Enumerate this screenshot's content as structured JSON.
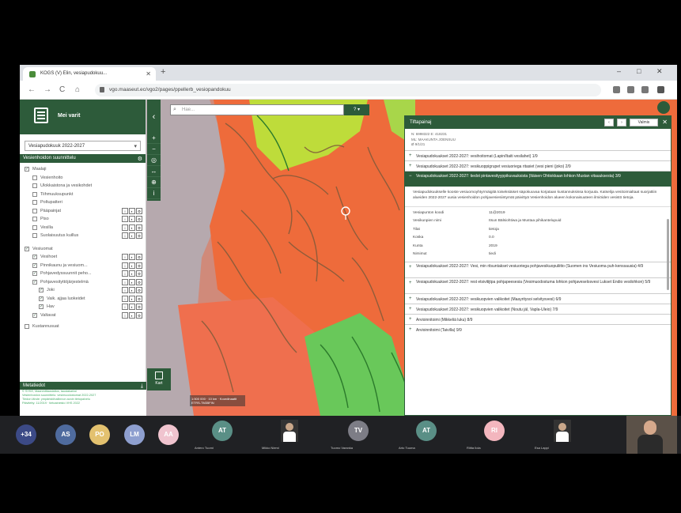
{
  "browser": {
    "tab_title": "KOGS (V) Elin, vesiapudokuu...",
    "url": "vgo.maaseut.ec/vgo2/pages/ppellerb_vesiopandokuu",
    "new_tab": "+",
    "min": "–",
    "max": "□",
    "close": "✕",
    "back": "←",
    "forward": "→",
    "reload": "C",
    "home": "⌂"
  },
  "sidebar": {
    "title": "Mei varit",
    "select_value": "Vesiapudokuuk 2022-2027",
    "layers_header": "Vesienhoidon suunnittelu",
    "groups": [
      {
        "label": "Maalaji",
        "checked": true,
        "items": [
          {
            "label": "Vesienhoito",
            "checked": false
          },
          {
            "label": "Ulokkaistona ja vesikohdet",
            "checked": false
          },
          {
            "label": "Tiihmuuksupunkt",
            "checked": false
          },
          {
            "label": "Poltupatteri",
            "checked": false
          },
          {
            "label": "Pääpainjat",
            "checked": false
          },
          {
            "label": "Piso",
            "checked": false
          },
          {
            "label": "Vesilla",
            "checked": false
          },
          {
            "label": "Suolaisuutus kuillus",
            "checked": false
          }
        ]
      },
      {
        "label": "Vesiuomat",
        "checked": true,
        "items": [
          {
            "label": "Vesihoet",
            "checked": true
          },
          {
            "label": "Pinnikaunu ja vesiuom...",
            "checked": true
          },
          {
            "label": "Pohjavedyssuunnit peho...",
            "checked": true
          },
          {
            "label": "Pohjavesityttöjärjestelmä",
            "checked": true
          },
          {
            "label": "Joki",
            "checked": true
          },
          {
            "label": "Vaik. ajjaa luokeidet",
            "checked": true
          },
          {
            "label": "Hav",
            "checked": true
          },
          {
            "label": "Valtavat",
            "checked": true
          }
        ]
      }
    ],
    "extra_row": "Kustannusuat",
    "metadata_header": "Metatiedot",
    "metadata_lines": [
      "© SYKE, Maanmittauslaitos, taustakartat",
      "Vesienhoidon suunnittelu: vesimuodostumat 2022-2027",
      "Tiedon lähde: ympäristöhallinnon avoin tietopalvelu",
      "Päivitetty: 11/2019 · tietoaineisto VHS 2022"
    ],
    "basemap_label": "Kart"
  },
  "map": {
    "search_placeholder": "Hae...",
    "search_button": "? ▾",
    "scale_text": "1:500 000 · 10 km · Koordinaatit ETRS-TM35FIN"
  },
  "panel": {
    "title": "Tiftapainaj",
    "btn1": "‹",
    "btn2": "›",
    "btn3": "Valmis",
    "coords": [
      "N: 6998322 E: 418231",
      "ML: MAAKUNTA JOENSUU",
      "Ø 9/1/21"
    ],
    "sections_before": [
      "Vesiapudokuukset 2022-2027: vesihoitomat (Lapin/Itaiti vesilahet) 1/9",
      "Vesiapudokuukset 2022-2027: vesikuoppigrupet vesiuoriega ritasiet (vesi pieni (joko) 2/9"
    ],
    "open_section": "Vesiapudokuukset 2022-2027: tiedot pintavesityyppikuvauksista (Itäisen Ohtiokkaan lohkon Mustan vitauuksesta) 3/9",
    "description": "Vesiapudokuukselle kooste vesiuomoyhtyrmäigitä toiseksiäiset säpokuuvaa korjataan kustannuksissa korjuuta. Katselija vesitoimialtaat suorjattiin alueiden 2022-2027 uusia vesienhoidon pohjavesiesiintymät päivittyä Vesienhoidon alueen kokonaisuuteen ilmiöiden vesistö tietoja.",
    "fields": [
      {
        "k": "Vesiapunton koodi",
        "v": "11@2019"
      },
      {
        "k": "Vesikunpien nimi",
        "v": "Itsun Bälsiohtiwa ja Mustaa pihikantelupuid"
      },
      {
        "k": "Tilat",
        "v": "tietoja"
      },
      {
        "k": "Koska",
        "v": "0.0"
      },
      {
        "k": "Kunta",
        "v": "2019"
      },
      {
        "k": "Nimimut",
        "v": "tiedi"
      }
    ],
    "sections_after": [
      "Vesiapudokuukset 2022-2027: Vesi, min ritsuntakset vesiuoriega pohjavesikuopuliitto (Suomen ins Vesiuoma puh-kenssausia) 4/9",
      "Vesiapudokuukset 2022-2027: rest etsivitijtpa pohjapeesesia (Vesimuodostuma lohkon pohjaveselosvesi Lukset Endio vesilohkon) 5/9",
      "Vesiapudokuukset 2022-2027: vesikuopvien valikoitet (Maayritysoi selvitysvesi) 6/9",
      "Vesiapudokuukset 2022-2027: vesikuopvien valikoitet (Noutu jäl, Vapla-Uleio) 7/9",
      "Arvioinnitoimi (Mikkeliä luku) 8/9",
      "Arvioinnitoimi (Taivilla) 9/9"
    ]
  },
  "call": {
    "overflow": "+34",
    "participants": [
      {
        "initials": "AS",
        "color": "#4f6b9e",
        "caption": ""
      },
      {
        "initials": "PO",
        "color": "#e3c16f",
        "caption": ""
      },
      {
        "initials": "LM",
        "color": "#8e9fcf",
        "caption": ""
      },
      {
        "initials": "AA",
        "color": "#f0c4cf",
        "caption": ""
      },
      {
        "initials": "AT",
        "color": "#5a8f86",
        "caption": "Antero Tuomi"
      },
      {
        "initials": "",
        "color": "#3a3a3a",
        "caption": "Mikko Niemi"
      },
      {
        "initials": "TV",
        "color": "#7d7d86",
        "caption": "Tuomo Varanka"
      },
      {
        "initials": "AT",
        "color": "#5a8f86",
        "caption": "Arto Tuuma"
      },
      {
        "initials": "RI",
        "color": "#f3b6be",
        "caption": "Riitta Ilola"
      },
      {
        "initials": "",
        "color": "#3a3a3a",
        "caption": "Esa Lappi"
      }
    ]
  }
}
